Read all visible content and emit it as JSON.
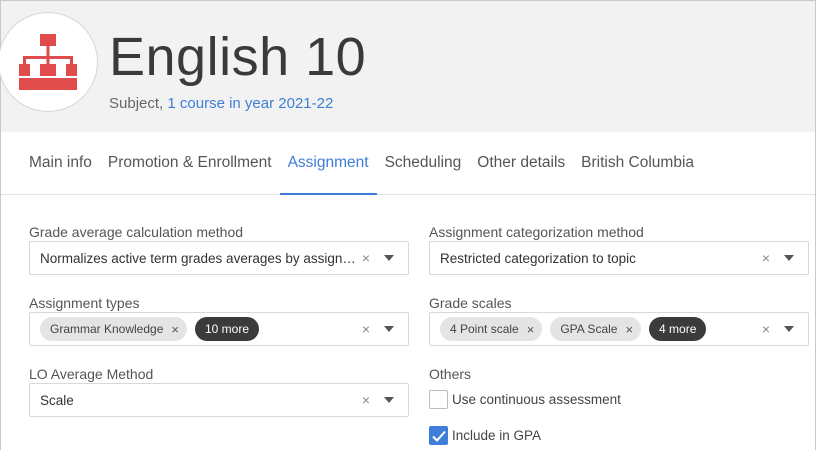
{
  "header": {
    "title": "English 10",
    "subtitle_prefix": "Subject, ",
    "subtitle_link": "1 course in year 2021-22",
    "logo_icon": "org-chart-icon",
    "logo_color": "#e04b4b"
  },
  "tabs": [
    {
      "label": "Main info",
      "active": false
    },
    {
      "label": "Promotion & Enrollment",
      "active": false
    },
    {
      "label": "Assignment",
      "active": true
    },
    {
      "label": "Scheduling",
      "active": false
    },
    {
      "label": "Other details",
      "active": false
    },
    {
      "label": "British Columbia",
      "active": false
    }
  ],
  "form": {
    "grade_average": {
      "label": "Grade average calculation method",
      "value": "Normalizes active term grades averages by assignment..."
    },
    "categorization": {
      "label": "Assignment categorization method",
      "value": "Restricted categorization to topic"
    },
    "assignment_types": {
      "label": "Assignment types",
      "chips": [
        "Grammar Knowledge"
      ],
      "more": "10 more"
    },
    "grade_scales": {
      "label": "Grade scales",
      "chips": [
        "4 Point scale",
        "GPA Scale"
      ],
      "more": "4 more"
    },
    "lo_average": {
      "label": "LO Average Method",
      "value": "Scale"
    },
    "others": {
      "label": "Others",
      "continuous": {
        "label": "Use continuous assessment",
        "checked": false
      },
      "gpa": {
        "label": "Include in GPA",
        "checked": true
      }
    }
  },
  "symbols": {
    "clear": "×",
    "chip_remove": "×",
    "check": "✓"
  },
  "colors": {
    "accent": "#3f7ed8",
    "chip_dark": "#3b3b3b"
  }
}
